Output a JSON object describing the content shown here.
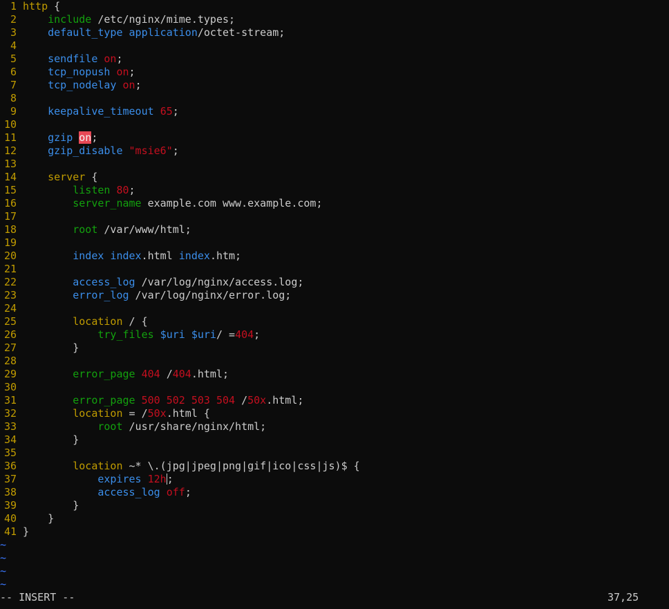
{
  "lines": [
    {
      "n": "1",
      "indent": "",
      "tokens": [
        [
          "http",
          "c-kw-orange"
        ],
        [
          " {",
          "c-plain"
        ]
      ]
    },
    {
      "n": "2",
      "indent": "    ",
      "tokens": [
        [
          "include",
          "c-kw-green"
        ],
        [
          " /etc/nginx/mime.types;",
          "c-plain"
        ]
      ]
    },
    {
      "n": "3",
      "indent": "    ",
      "tokens": [
        [
          "default_type",
          "c-kw-blue"
        ],
        [
          " ",
          "c-plain"
        ],
        [
          "application",
          "c-kw-blue"
        ],
        [
          "/octet-stream;",
          "c-plain"
        ]
      ]
    },
    {
      "n": "4",
      "indent": "",
      "tokens": []
    },
    {
      "n": "5",
      "indent": "    ",
      "tokens": [
        [
          "sendfile",
          "c-kw-blue"
        ],
        [
          " ",
          "c-plain"
        ],
        [
          "on",
          "c-val-red"
        ],
        [
          ";",
          "c-plain"
        ]
      ]
    },
    {
      "n": "6",
      "indent": "    ",
      "tokens": [
        [
          "tcp_nopush",
          "c-kw-blue"
        ],
        [
          " ",
          "c-plain"
        ],
        [
          "on",
          "c-val-red"
        ],
        [
          ";",
          "c-plain"
        ]
      ]
    },
    {
      "n": "7",
      "indent": "    ",
      "tokens": [
        [
          "tcp_nodelay",
          "c-kw-blue"
        ],
        [
          " ",
          "c-plain"
        ],
        [
          "on",
          "c-val-red"
        ],
        [
          ";",
          "c-plain"
        ]
      ]
    },
    {
      "n": "8",
      "indent": "",
      "tokens": []
    },
    {
      "n": "9",
      "indent": "    ",
      "tokens": [
        [
          "keepalive_timeout",
          "c-kw-blue"
        ],
        [
          " ",
          "c-plain"
        ],
        [
          "65",
          "c-val-red"
        ],
        [
          ";",
          "c-plain"
        ]
      ]
    },
    {
      "n": "10",
      "indent": "",
      "tokens": []
    },
    {
      "n": "11",
      "indent": "    ",
      "tokens": [
        [
          "gzip",
          "c-kw-blue"
        ],
        [
          " ",
          "c-plain"
        ],
        [
          "on",
          "c-hl"
        ],
        [
          ";",
          "c-plain"
        ]
      ]
    },
    {
      "n": "12",
      "indent": "    ",
      "tokens": [
        [
          "gzip_disable",
          "c-kw-blue"
        ],
        [
          " ",
          "c-plain"
        ],
        [
          "\"msie6\"",
          "c-val-red"
        ],
        [
          ";",
          "c-plain"
        ]
      ]
    },
    {
      "n": "13",
      "indent": "",
      "tokens": []
    },
    {
      "n": "14",
      "indent": "    ",
      "tokens": [
        [
          "server",
          "c-kw-orange"
        ],
        [
          " {",
          "c-plain"
        ]
      ]
    },
    {
      "n": "15",
      "indent": "        ",
      "tokens": [
        [
          "listen",
          "c-kw-green"
        ],
        [
          " ",
          "c-plain"
        ],
        [
          "80",
          "c-val-red"
        ],
        [
          ";",
          "c-plain"
        ]
      ]
    },
    {
      "n": "16",
      "indent": "        ",
      "tokens": [
        [
          "server_name",
          "c-kw-green"
        ],
        [
          " example.com www.example.com;",
          "c-plain"
        ]
      ]
    },
    {
      "n": "17",
      "indent": "",
      "tokens": []
    },
    {
      "n": "18",
      "indent": "        ",
      "tokens": [
        [
          "root",
          "c-kw-green"
        ],
        [
          " /var/www/html;",
          "c-plain"
        ]
      ]
    },
    {
      "n": "19",
      "indent": "",
      "tokens": []
    },
    {
      "n": "20",
      "indent": "        ",
      "tokens": [
        [
          "index",
          "c-kw-blue"
        ],
        [
          " ",
          "c-plain"
        ],
        [
          "index",
          "c-kw-blue"
        ],
        [
          ".html ",
          "c-plain"
        ],
        [
          "index",
          "c-kw-blue"
        ],
        [
          ".htm;",
          "c-plain"
        ]
      ]
    },
    {
      "n": "21",
      "indent": "",
      "tokens": []
    },
    {
      "n": "22",
      "indent": "        ",
      "tokens": [
        [
          "access_log",
          "c-kw-blue"
        ],
        [
          " /var/log/nginx/access.log;",
          "c-plain"
        ]
      ]
    },
    {
      "n": "23",
      "indent": "        ",
      "tokens": [
        [
          "error_log",
          "c-kw-blue"
        ],
        [
          " /var/log/nginx/error.log;",
          "c-plain"
        ]
      ]
    },
    {
      "n": "24",
      "indent": "",
      "tokens": []
    },
    {
      "n": "25",
      "indent": "        ",
      "tokens": [
        [
          "location",
          "c-kw-orange"
        ],
        [
          " / {",
          "c-plain"
        ]
      ]
    },
    {
      "n": "26",
      "indent": "            ",
      "tokens": [
        [
          "try_files",
          "c-kw-green"
        ],
        [
          " ",
          "c-plain"
        ],
        [
          "$uri",
          "c-var-blue"
        ],
        [
          " ",
          "c-plain"
        ],
        [
          "$uri",
          "c-var-blue"
        ],
        [
          "/ =",
          "c-plain"
        ],
        [
          "404",
          "c-val-red"
        ],
        [
          ";",
          "c-plain"
        ]
      ]
    },
    {
      "n": "27",
      "indent": "        ",
      "tokens": [
        [
          "}",
          "c-plain"
        ]
      ]
    },
    {
      "n": "28",
      "indent": "",
      "tokens": []
    },
    {
      "n": "29",
      "indent": "        ",
      "tokens": [
        [
          "error_page",
          "c-kw-green"
        ],
        [
          " ",
          "c-plain"
        ],
        [
          "404",
          "c-val-red"
        ],
        [
          " /",
          "c-plain"
        ],
        [
          "404",
          "c-val-red"
        ],
        [
          ".html;",
          "c-plain"
        ]
      ]
    },
    {
      "n": "30",
      "indent": "",
      "tokens": []
    },
    {
      "n": "31",
      "indent": "        ",
      "tokens": [
        [
          "error_page",
          "c-kw-green"
        ],
        [
          " ",
          "c-plain"
        ],
        [
          "500 502 503 504",
          "c-val-red"
        ],
        [
          " /",
          "c-plain"
        ],
        [
          "50x",
          "c-val-red"
        ],
        [
          ".html;",
          "c-plain"
        ]
      ]
    },
    {
      "n": "32",
      "indent": "        ",
      "tokens": [
        [
          "location",
          "c-kw-orange"
        ],
        [
          " = /",
          "c-plain"
        ],
        [
          "50x",
          "c-val-red"
        ],
        [
          ".html {",
          "c-plain"
        ]
      ]
    },
    {
      "n": "33",
      "indent": "            ",
      "tokens": [
        [
          "root",
          "c-kw-green"
        ],
        [
          " /usr/share/nginx/html;",
          "c-plain"
        ]
      ]
    },
    {
      "n": "34",
      "indent": "        ",
      "tokens": [
        [
          "}",
          "c-plain"
        ]
      ]
    },
    {
      "n": "35",
      "indent": "",
      "tokens": []
    },
    {
      "n": "36",
      "indent": "        ",
      "tokens": [
        [
          "location",
          "c-kw-orange"
        ],
        [
          " ~* \\.(jpg|jpeg|png|gif|ico|css|js)$ {",
          "c-plain"
        ]
      ]
    },
    {
      "n": "37",
      "indent": "            ",
      "tokens": [
        [
          "expires",
          "c-kw-blue"
        ],
        [
          " ",
          "c-plain"
        ],
        [
          "12h",
          "c-val-red"
        ],
        [
          ";",
          "c-plain"
        ]
      ],
      "cursor": true
    },
    {
      "n": "38",
      "indent": "            ",
      "tokens": [
        [
          "access_log",
          "c-kw-blue"
        ],
        [
          " ",
          "c-plain"
        ],
        [
          "off",
          "c-val-red"
        ],
        [
          ";",
          "c-plain"
        ]
      ]
    },
    {
      "n": "39",
      "indent": "        ",
      "tokens": [
        [
          "}",
          "c-plain"
        ]
      ]
    },
    {
      "n": "40",
      "indent": "    ",
      "tokens": [
        [
          "}",
          "c-plain"
        ]
      ]
    },
    {
      "n": "41",
      "indent": "",
      "tokens": [
        [
          "}",
          "c-plain"
        ]
      ]
    }
  ],
  "tildes": [
    "~",
    "~",
    "~",
    "~"
  ],
  "status": {
    "mode": "-- INSERT --",
    "position": "37,25"
  },
  "colors": {
    "background": "#0c0c0c",
    "line_number": "#c19c00",
    "keyword_orange": "#c19c00",
    "keyword_green": "#13a10e",
    "keyword_blue": "#3b8eea",
    "value_red": "#c50f1f",
    "highlight": "#e74856",
    "tilde": "#3b78ff",
    "text": "#cccccc"
  }
}
